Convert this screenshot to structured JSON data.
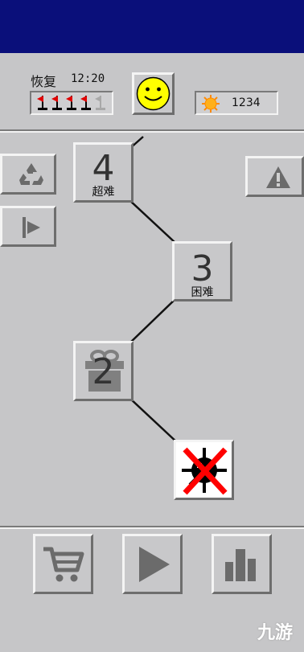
{
  "header": {
    "status_label": "恢复",
    "timer": "12:20",
    "coins": "1234",
    "flags_remaining": 4,
    "flags_total": 5
  },
  "path": {
    "nodes": [
      {
        "number": "4",
        "difficulty": "超难"
      },
      {
        "number": "3",
        "difficulty": "困难"
      },
      {
        "number": "2",
        "difficulty": ""
      }
    ]
  },
  "colors": {
    "topbar": "#0a0f7a",
    "panel": "#c8c8ca",
    "face": "#ffff00",
    "flag": "#e00000",
    "cross": "#ff0000"
  },
  "icons": {
    "recycle": "recycle-icon",
    "flag_button": "flag-icon",
    "warning": "warning-icon",
    "gift": "gift-icon",
    "mine": "mine-icon",
    "cart": "cart-icon",
    "play": "play-icon",
    "stats": "bar-chart-icon",
    "sun": "sun-coin-icon",
    "smiley": "smiley-face-icon"
  },
  "watermark": "九游"
}
